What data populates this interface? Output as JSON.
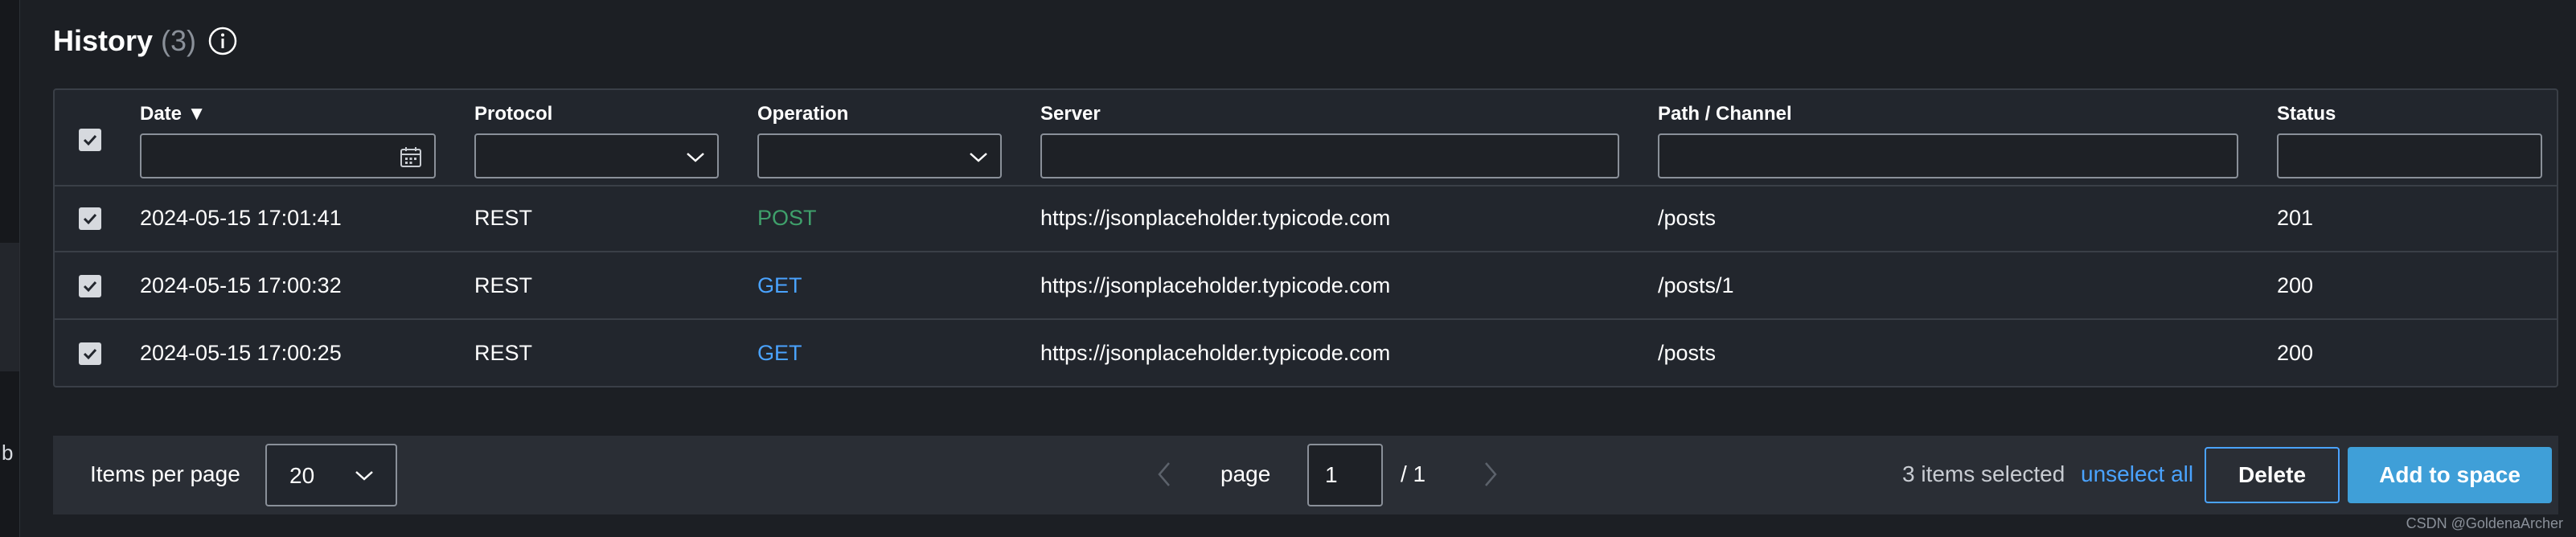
{
  "title": "History",
  "count": "(3)",
  "columns": {
    "date": "Date",
    "protocol": "Protocol",
    "operation": "Operation",
    "server": "Server",
    "path": "Path / Channel",
    "status": "Status"
  },
  "sort_indicator": "▼",
  "rows": [
    {
      "date": "2024-05-15 17:01:41",
      "protocol": "REST",
      "operation": "POST",
      "server": "https://jsonplaceholder.typicode.com",
      "path": "/posts",
      "status": "201"
    },
    {
      "date": "2024-05-15 17:00:32",
      "protocol": "REST",
      "operation": "GET",
      "server": "https://jsonplaceholder.typicode.com",
      "path": "/posts/1",
      "status": "200"
    },
    {
      "date": "2024-05-15 17:00:25",
      "protocol": "REST",
      "operation": "GET",
      "server": "https://jsonplaceholder.typicode.com",
      "path": "/posts",
      "status": "200"
    }
  ],
  "pagination": {
    "items_per_page_label": "Items per page",
    "items_per_page_value": "20",
    "page_label": "page",
    "page_value": "1",
    "page_total": "/ 1"
  },
  "selection": {
    "text": "3 items selected",
    "unselect_label": "unselect all",
    "delete_label": "Delete",
    "add_label": "Add to space"
  },
  "sidebar_letter": "b",
  "watermark": "CSDN @GoldenaArcher",
  "colors": {
    "accent": "#4aa3ff",
    "post": "#3fa06b",
    "get": "#4aa3ff",
    "add_button": "#3f9fd8"
  }
}
